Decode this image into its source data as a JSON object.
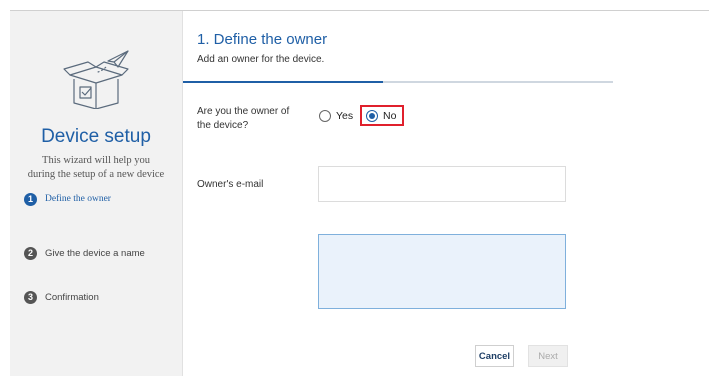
{
  "sidebar": {
    "title": "Device setup",
    "subtitle_line1": "This wizard will help you",
    "subtitle_line2": "during the setup of a new device",
    "steps": [
      {
        "number": "1",
        "label": "Define the owner",
        "active": true
      },
      {
        "number": "2",
        "label": "Give the device a name",
        "active": false
      },
      {
        "number": "3",
        "label": "Confirmation",
        "active": false
      }
    ],
    "icon": "box-with-paper-plane-icon"
  },
  "main": {
    "title": "1. Define the owner",
    "description": "Add an owner for the device.",
    "question_line1": "Are you the owner of",
    "question_line2": "the device?",
    "options": [
      {
        "label": "Yes",
        "selected": false
      },
      {
        "label": "No",
        "selected": true
      }
    ],
    "email_label": "Owner's e-mail",
    "email_value": "",
    "notes_value": "",
    "cancel_label": "Cancel",
    "next_label": "Next"
  },
  "colors": {
    "accent": "#1f5fa6",
    "highlight": "#e0202c",
    "sidebar_bg": "#f2f2f2"
  }
}
